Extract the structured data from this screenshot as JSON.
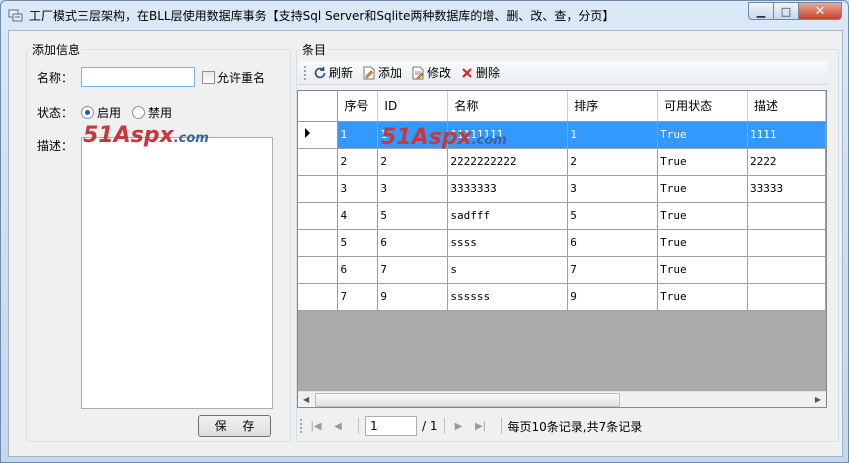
{
  "window": {
    "title": "工厂模式三层架构，在BLL层使用数据库事务【支持Sql Server和Sqlite两种数据库的增、删、改、查，分页】",
    "minimize_glyph": "▁",
    "maximize_glyph": "□",
    "close_glyph": "✕"
  },
  "left_panel": {
    "legend": "添加信息",
    "name_label": "名称：",
    "name_value": "",
    "allow_duplicate_label": "允许重名",
    "allow_duplicate_checked": false,
    "status_label": "状态：",
    "status_enabled_label": "启用",
    "status_disabled_label": "禁用",
    "status_selected": "启用",
    "desc_label": "描述：",
    "desc_value": "",
    "save_button": "保 存",
    "watermark_num": "51",
    "watermark_text": "Aspx",
    "watermark_domain": ".com"
  },
  "right_panel": {
    "legend": "条目",
    "toolbar": {
      "refresh": "刷新",
      "add": "添加",
      "edit": "修改",
      "delete": "删除"
    },
    "grid": {
      "columns": [
        "序号",
        "ID",
        "名称",
        "排序",
        "可用状态",
        "描述"
      ],
      "selected_row": 0,
      "rows": [
        [
          "1",
          "1",
          "11111111",
          "1",
          "True",
          "1111"
        ],
        [
          "2",
          "2",
          "2222222222",
          "2",
          "True",
          "2222"
        ],
        [
          "3",
          "3",
          "3333333",
          "3",
          "True",
          "33333"
        ],
        [
          "4",
          "5",
          "sadfff",
          "5",
          "True",
          ""
        ],
        [
          "5",
          "6",
          "ssss",
          "6",
          "True",
          ""
        ],
        [
          "6",
          "7",
          "s",
          "7",
          "True",
          ""
        ],
        [
          "7",
          "9",
          "ssssss",
          "9",
          "True",
          ""
        ]
      ]
    },
    "pager": {
      "current_page": "1",
      "total_pages": "/ 1",
      "summary": "每页10条记录,共7条记录"
    }
  },
  "colors": {
    "selection": "#3399ff",
    "watermark_red": "#c8383a",
    "watermark_blue": "#3b62a8",
    "delete_icon": "#d9261c"
  }
}
